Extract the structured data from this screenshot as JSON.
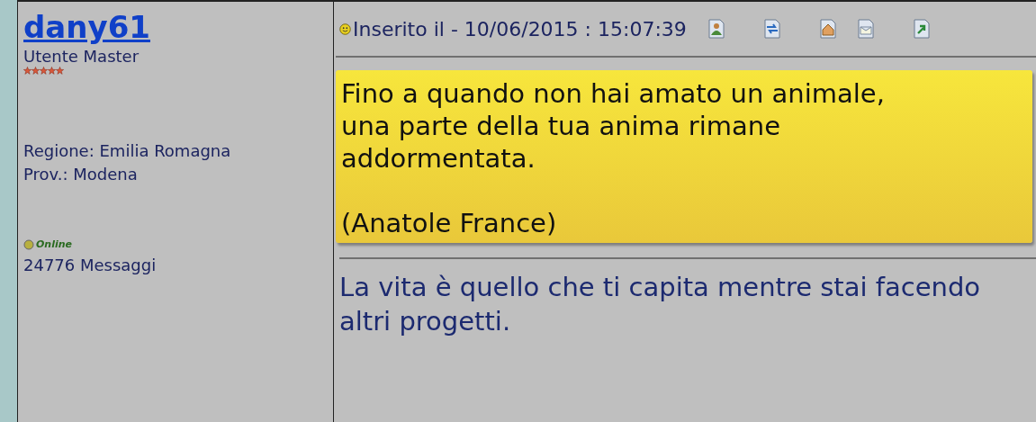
{
  "author": {
    "name": "dany61",
    "rank": "Utente Master",
    "stars": 5,
    "region": "Regione: Emilia Romagna",
    "province": "Prov.: Modena",
    "status": "Online",
    "online": true,
    "posts": "24776 Messaggi"
  },
  "post": {
    "posted": "Inserito il - 10/06/2015 : 15:07:39",
    "toolbar": [
      {
        "kind": "profile"
      },
      {
        "kind": "reply"
      },
      {
        "kind": "home"
      },
      {
        "kind": "mail"
      },
      {
        "kind": "quote"
      }
    ],
    "quote_lines": [
      "Fino a quando non hai amato un animale,",
      "una parte della tua anima rimane",
      "addormentata."
    ],
    "quote_author": "(Anatole France)",
    "signature": "La vita è quello che ti capita mentre stai facendo altri progetti."
  }
}
